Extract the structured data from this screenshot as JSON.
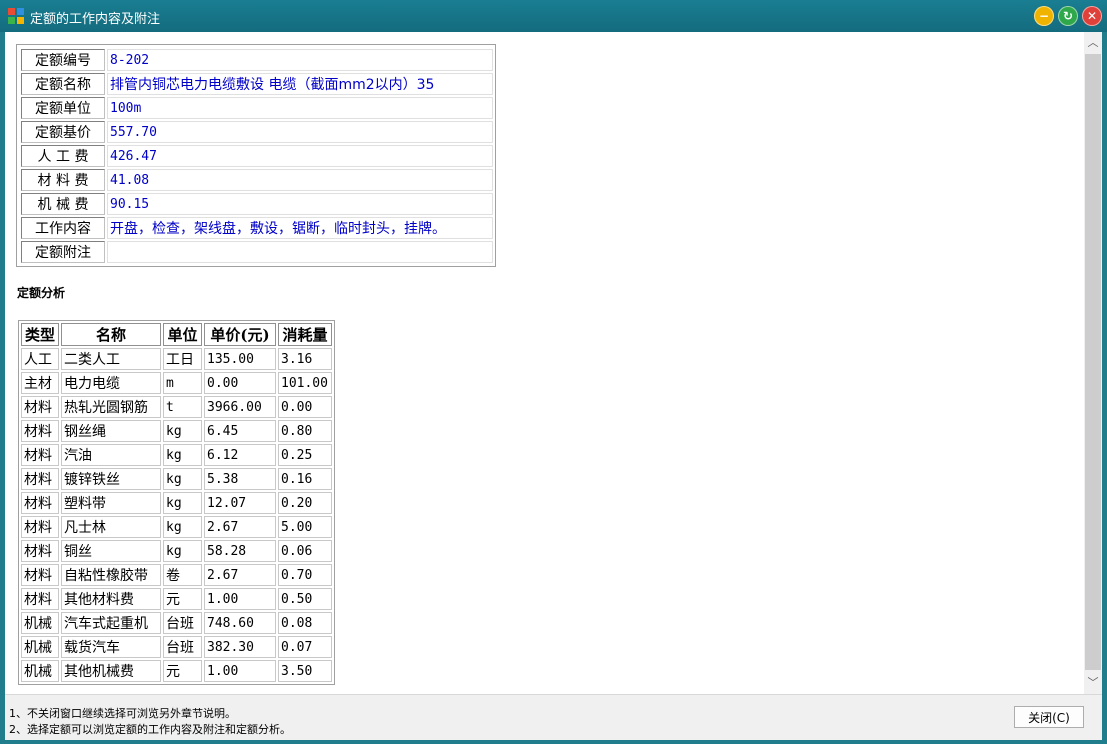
{
  "window": {
    "title": "定额的工作内容及附注",
    "colors": {
      "titlebar": "#1a7e92",
      "minimize": "#f0b400",
      "maximize": "#2ea84a",
      "close": "#e0403a"
    }
  },
  "quota_info": [
    {
      "label": "定额编号",
      "value": "8-202"
    },
    {
      "label": "定额名称",
      "value": "排管内铜芯电力电缆敷设 电缆（截面mm2以内）35"
    },
    {
      "label": "定额单位",
      "value": "100m"
    },
    {
      "label": "定额基价",
      "value": "557.70"
    },
    {
      "label": "人 工 费",
      "value": "426.47"
    },
    {
      "label": "材 料 费",
      "value": "41.08"
    },
    {
      "label": "机 械 费",
      "value": "90.15"
    },
    {
      "label": "工作内容",
      "value": "开盘，检查，架线盘，敷设，锯断，临时封头，挂牌。"
    },
    {
      "label": "定额附注",
      "value": ""
    }
  ],
  "analysis": {
    "title": "定额分析",
    "headers": [
      "类型",
      "名称",
      "单位",
      "单价(元)",
      "消耗量"
    ],
    "rows": [
      [
        "人工",
        "二类人工",
        "工日",
        "135.00",
        "3.16"
      ],
      [
        "主材",
        "电力电缆",
        "m",
        "0.00",
        "101.00"
      ],
      [
        "材料",
        "热轧光圆钢筋",
        "t",
        "3966.00",
        "0.00"
      ],
      [
        "材料",
        "钢丝绳",
        "kg",
        "6.45",
        "0.80"
      ],
      [
        "材料",
        "汽油",
        "kg",
        "6.12",
        "0.25"
      ],
      [
        "材料",
        "镀锌铁丝",
        "kg",
        "5.38",
        "0.16"
      ],
      [
        "材料",
        "塑料带",
        "kg",
        "12.07",
        "0.20"
      ],
      [
        "材料",
        "凡士林",
        "kg",
        "2.67",
        "5.00"
      ],
      [
        "材料",
        "铜丝",
        "kg",
        "58.28",
        "0.06"
      ],
      [
        "材料",
        "自粘性橡胶带",
        "卷",
        "2.67",
        "0.70"
      ],
      [
        "材料",
        "其他材料费",
        "元",
        "1.00",
        "0.50"
      ],
      [
        "机械",
        "汽车式起重机",
        "台班",
        "748.60",
        "0.08"
      ],
      [
        "机械",
        "载货汽车",
        "台班",
        "382.30",
        "0.07"
      ],
      [
        "机械",
        "其他机械费",
        "元",
        "1.00",
        "3.50"
      ]
    ]
  },
  "footer": {
    "notes": [
      "1、不关闭窗口继续选择可浏览另外章节说明。",
      "2、选择定额可以浏览定额的工作内容及附注和定额分析。"
    ],
    "close_label": "关闭(C)"
  }
}
